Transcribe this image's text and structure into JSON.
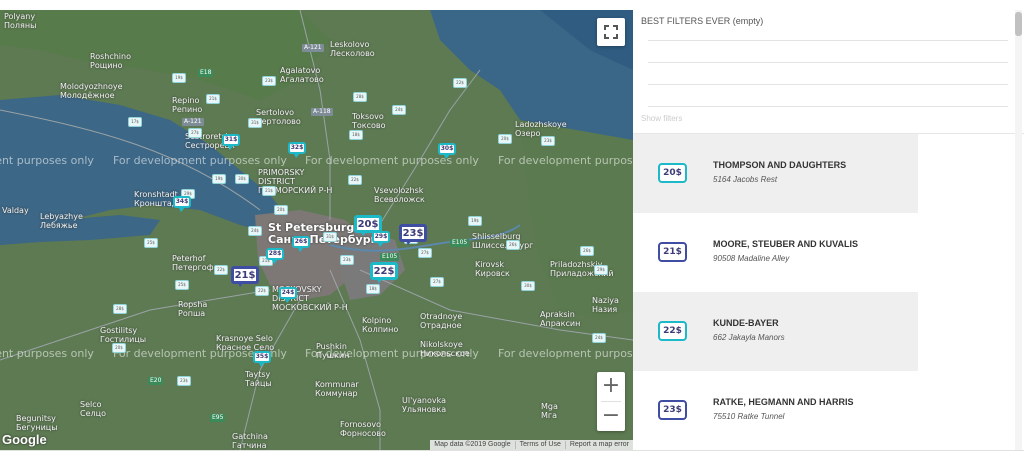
{
  "colors": {
    "teal": "#1cb9c8",
    "indigo": "#3f4da3"
  },
  "map": {
    "places": [
      {
        "name": "Polyany\nПоляны"
      },
      {
        "name": "Roshchino\nРощино"
      },
      {
        "name": "Leskolovo\nЛесколово"
      },
      {
        "name": "Agalatovo\nАгалатово"
      },
      {
        "name": "Molodyozhnoye\nМолодёжное"
      },
      {
        "name": "Repino\nРепино"
      },
      {
        "name": "Sertolovo\nСертолово"
      },
      {
        "name": "Toksovo\nТоксово"
      },
      {
        "name": "Ladozhskoye\nОзеро"
      },
      {
        "name": "Sestroretsk\nСестрорецк"
      },
      {
        "name": "PRIMORSKY\nDISTRICT\nПРИМОРСКИЙ Р-Н"
      },
      {
        "name": "Kronshtadt\nКронштадт"
      },
      {
        "name": "Vsevolozhsk\nВсеволожск"
      },
      {
        "name": "Valday"
      },
      {
        "name": "Lebyazhye\nЛебяжье"
      },
      {
        "name": "St Petersburg\nСанкт-Петербург"
      },
      {
        "name": "Shlisselburg\nШлиссельбург"
      },
      {
        "name": "Peterhof\nПетергоф"
      },
      {
        "name": "Kirovsk\nКировск"
      },
      {
        "name": "Priladozhskiy\nПриладожский"
      },
      {
        "name": "MOSKOVSKY\nDISTRICT\nМОСКОВСКИЙ Р-Н"
      },
      {
        "name": "Ropsha\nРопша"
      },
      {
        "name": "Kolpino\nКолпино"
      },
      {
        "name": "Otradnoye\nОтрадное"
      },
      {
        "name": "Apraksin\nАпраксин"
      },
      {
        "name": "Naziya\nНазия"
      },
      {
        "name": "Gostilitsy\nГостилицы"
      },
      {
        "name": "Krasnoye Selo\nКрасное Село"
      },
      {
        "name": "Pushkin\nПушкин"
      },
      {
        "name": "Nikolskoye\nНикольское"
      },
      {
        "name": "Taytsy\nТайцы"
      },
      {
        "name": "Kommunar\nКоммунар"
      },
      {
        "name": "Ul'yanovka\nУльяновка"
      },
      {
        "name": "Mga\nМга"
      },
      {
        "name": "Begunitsy\nБегуницы"
      },
      {
        "name": "Gatchina\nГатчина"
      },
      {
        "name": "Fornosovo\nФорносово"
      },
      {
        "name": "Selco\nСелцо"
      }
    ],
    "roads": [
      "A-121",
      "E18",
      "A-121",
      "A-118",
      "E105",
      "E105",
      "E20",
      "E95"
    ],
    "watermark": "For development purposes only",
    "mini_markers": [
      "19$",
      "17$",
      "21$",
      "23$",
      "28$",
      "24$",
      "22$",
      "20$",
      "23$",
      "31$",
      "27$",
      "29$",
      "19$",
      "30$",
      "21$",
      "22$",
      "18$",
      "25$",
      "24$",
      "20$",
      "19$",
      "27$",
      "26$",
      "23$",
      "31$",
      "21$",
      "22$",
      "28$",
      "25$",
      "24$",
      "29$",
      "30$",
      "26$",
      "20$",
      "23$",
      "21$",
      "27$",
      "18$",
      "22$"
    ],
    "pins": [
      {
        "label": "31$",
        "color": "teal"
      },
      {
        "label": "32$",
        "color": "teal"
      },
      {
        "label": "30$",
        "color": "teal"
      },
      {
        "label": "34$",
        "color": "teal"
      },
      {
        "label": "20$",
        "color": "teal"
      },
      {
        "label": "23$",
        "color": "indigo"
      },
      {
        "label": "29$",
        "color": "teal"
      },
      {
        "label": "26$",
        "color": "teal"
      },
      {
        "label": "28$",
        "color": "teal"
      },
      {
        "label": "21$",
        "color": "indigo"
      },
      {
        "label": "22$",
        "color": "teal"
      },
      {
        "label": "24$",
        "color": "teal"
      },
      {
        "label": "35$",
        "color": "teal"
      }
    ],
    "zoom_in": "+",
    "zoom_out": "−",
    "google": "Google",
    "footer": [
      "Map data ©2019 Google",
      "Terms of Use",
      "Report a map error"
    ]
  },
  "filters": {
    "title": "BEST FILTERS EVER (empty)",
    "show_label": "Show filters"
  },
  "listings": [
    {
      "price": "20$",
      "color": "teal",
      "name": "THOMPSON AND DAUGHTERS",
      "address": "5164 Jacobs Rest"
    },
    {
      "price": "21$",
      "color": "indigo",
      "name": "MOORE, STEUBER AND KUVALIS",
      "address": "90508 Madaline Alley"
    },
    {
      "price": "22$",
      "color": "teal",
      "name": "KUNDE-BAYER",
      "address": "662 Jakayla Manors"
    },
    {
      "price": "23$",
      "color": "indigo",
      "name": "RATKE, HEGMANN AND HARRIS",
      "address": "75510 Ratke Tunnel"
    }
  ]
}
